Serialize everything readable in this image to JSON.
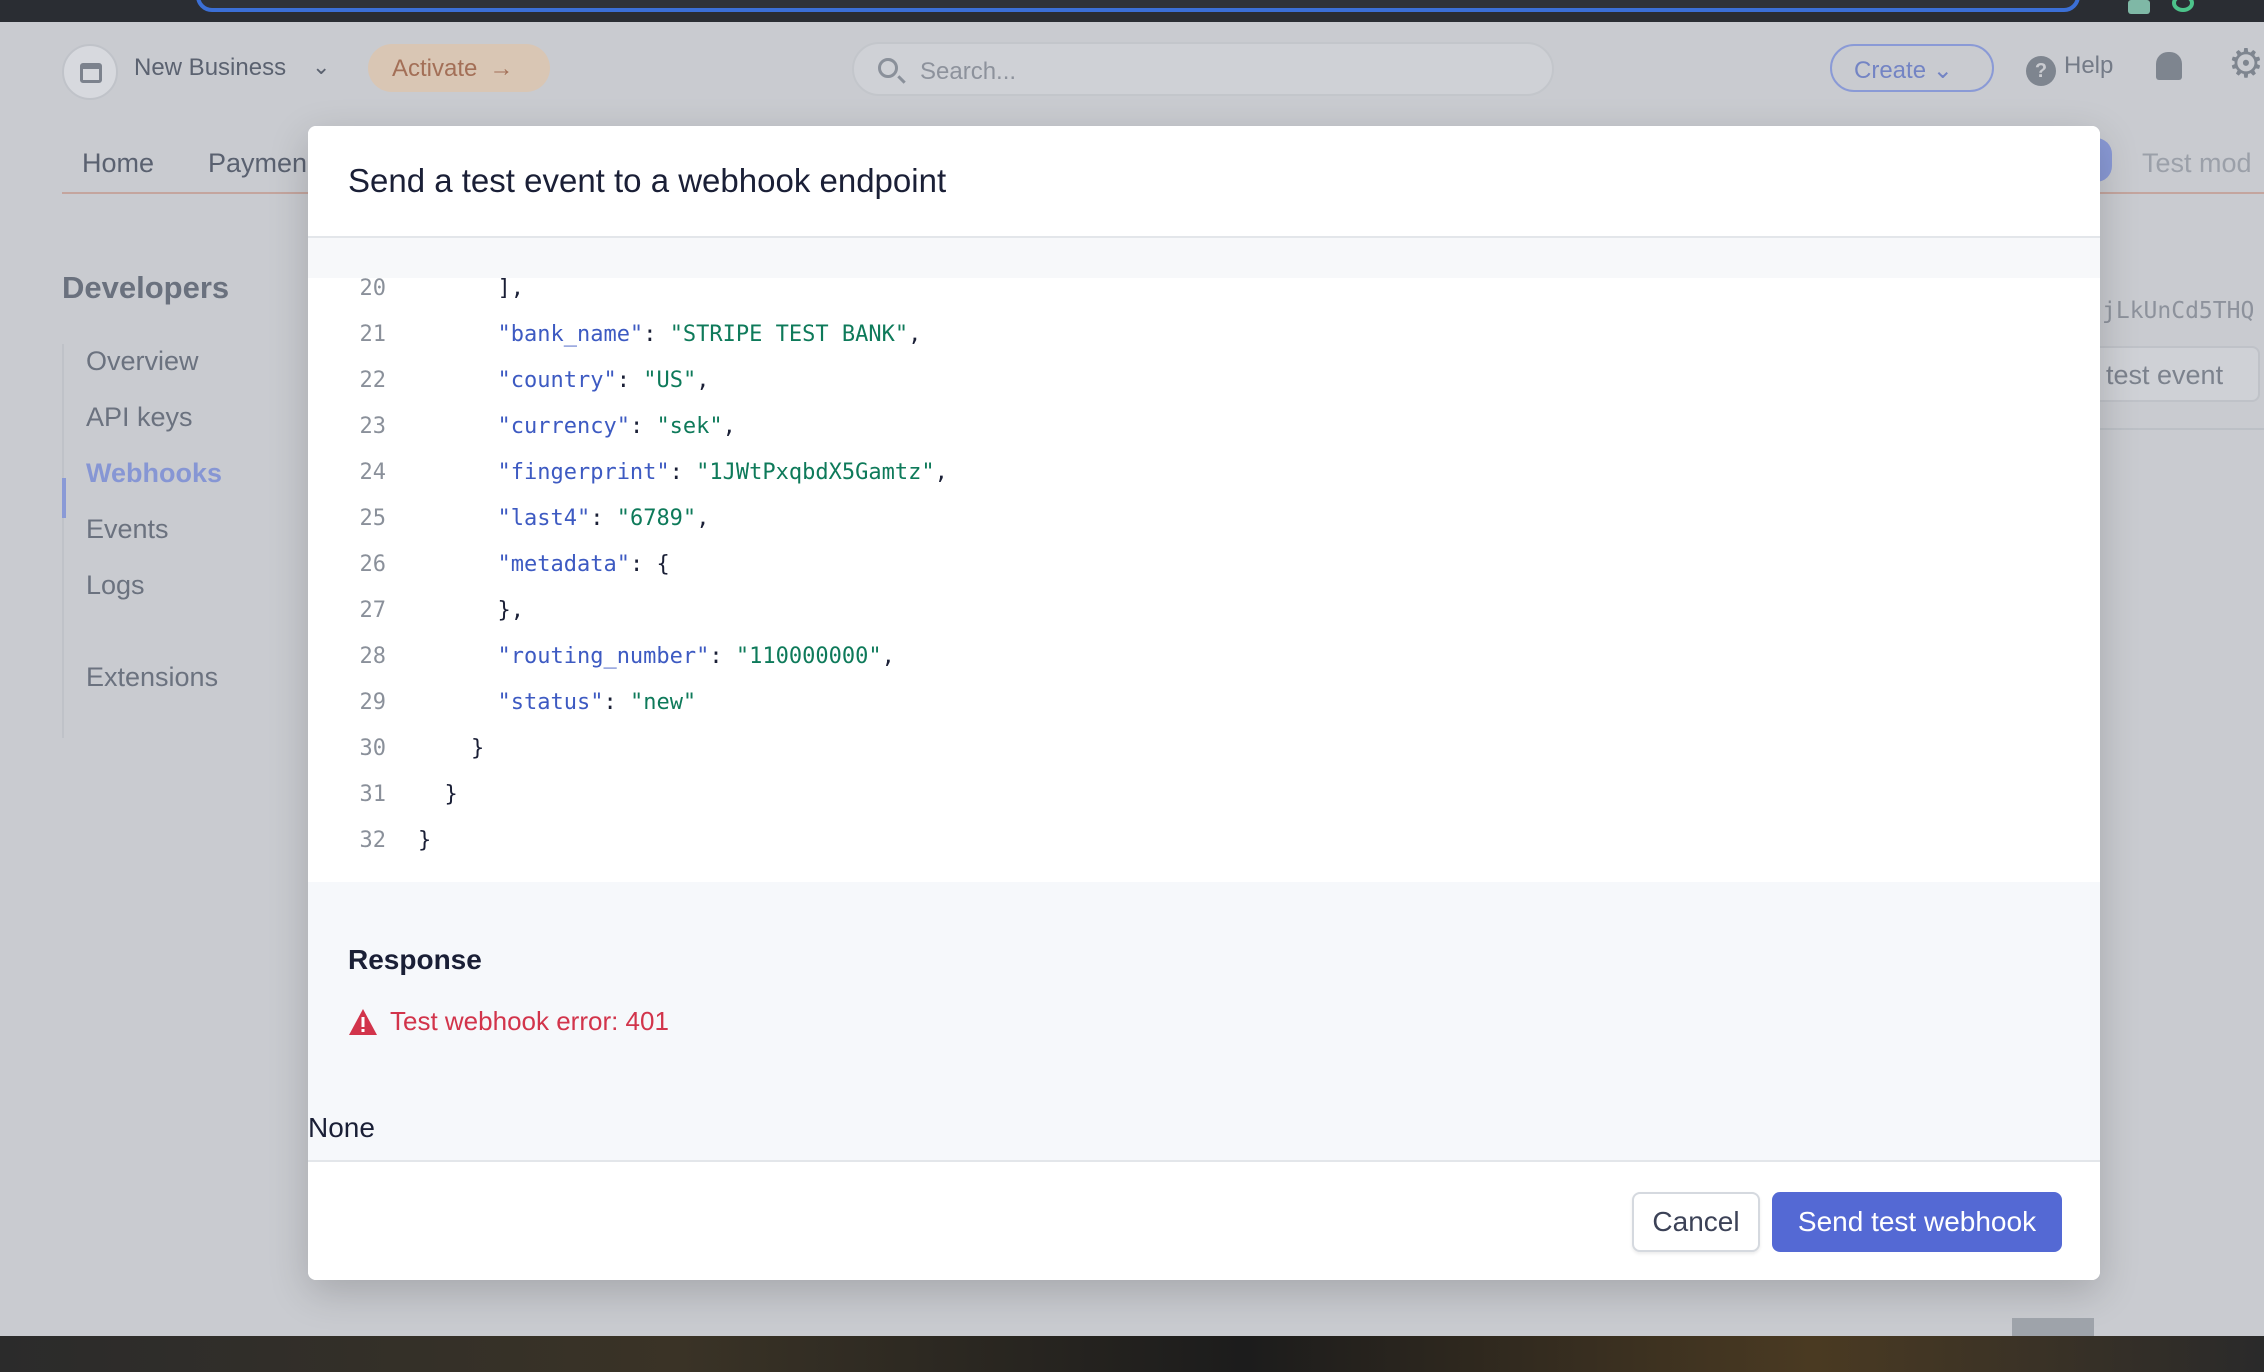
{
  "header": {
    "business_name": "New Business",
    "activate_label": "Activate",
    "search_placeholder": "Search...",
    "create_label": "Create",
    "help_label": "Help"
  },
  "nav": {
    "tabs": [
      "Home",
      "Paymen"
    ],
    "test_mode_label": "Test mod"
  },
  "sidebar": {
    "title": "Developers",
    "items": [
      "Overview",
      "API keys",
      "Webhooks",
      "Events",
      "Logs",
      "Extensions"
    ],
    "active_item": "Webhooks"
  },
  "background": {
    "key_fragment": "jLkUnCd5THQ",
    "button_fragment": "test event"
  },
  "modal": {
    "title": "Send a test event to a webhook endpoint",
    "code_lines": [
      {
        "n": "20",
        "indent": "      ",
        "text": "],"
      },
      {
        "n": "21",
        "indent": "      ",
        "key": "\"bank_name\"",
        "sep": ": ",
        "val": "\"STRIPE TEST BANK\"",
        "end": ","
      },
      {
        "n": "22",
        "indent": "      ",
        "key": "\"country\"",
        "sep": ": ",
        "val": "\"US\"",
        "end": ","
      },
      {
        "n": "23",
        "indent": "      ",
        "key": "\"currency\"",
        "sep": ": ",
        "val": "\"sek\"",
        "end": ","
      },
      {
        "n": "24",
        "indent": "      ",
        "key": "\"fingerprint\"",
        "sep": ": ",
        "val": "\"1JWtPxqbdX5Gamtz\"",
        "end": ","
      },
      {
        "n": "25",
        "indent": "      ",
        "key": "\"last4\"",
        "sep": ": ",
        "val": "\"6789\"",
        "end": ","
      },
      {
        "n": "26",
        "indent": "      ",
        "key": "\"metadata\"",
        "sep": ": ",
        "val": "",
        "end": "{"
      },
      {
        "n": "27",
        "indent": "      ",
        "text": "},"
      },
      {
        "n": "28",
        "indent": "      ",
        "key": "\"routing_number\"",
        "sep": ": ",
        "val": "\"110000000\"",
        "end": ","
      },
      {
        "n": "29",
        "indent": "      ",
        "key": "\"status\"",
        "sep": ": ",
        "val": "\"new\"",
        "end": ""
      },
      {
        "n": "30",
        "indent": "    ",
        "text": "}"
      },
      {
        "n": "31",
        "indent": "  ",
        "text": "}"
      },
      {
        "n": "32",
        "indent": "",
        "text": "}"
      }
    ],
    "response_title": "Response",
    "response_error": "Test webhook error: 401",
    "response_body": "None",
    "cancel_label": "Cancel",
    "send_label": "Send test webhook"
  },
  "colors": {
    "primary": "#5469d4",
    "error": "#d2344b",
    "code_key": "#3d5ac2",
    "code_string": "#0e7a5a"
  }
}
